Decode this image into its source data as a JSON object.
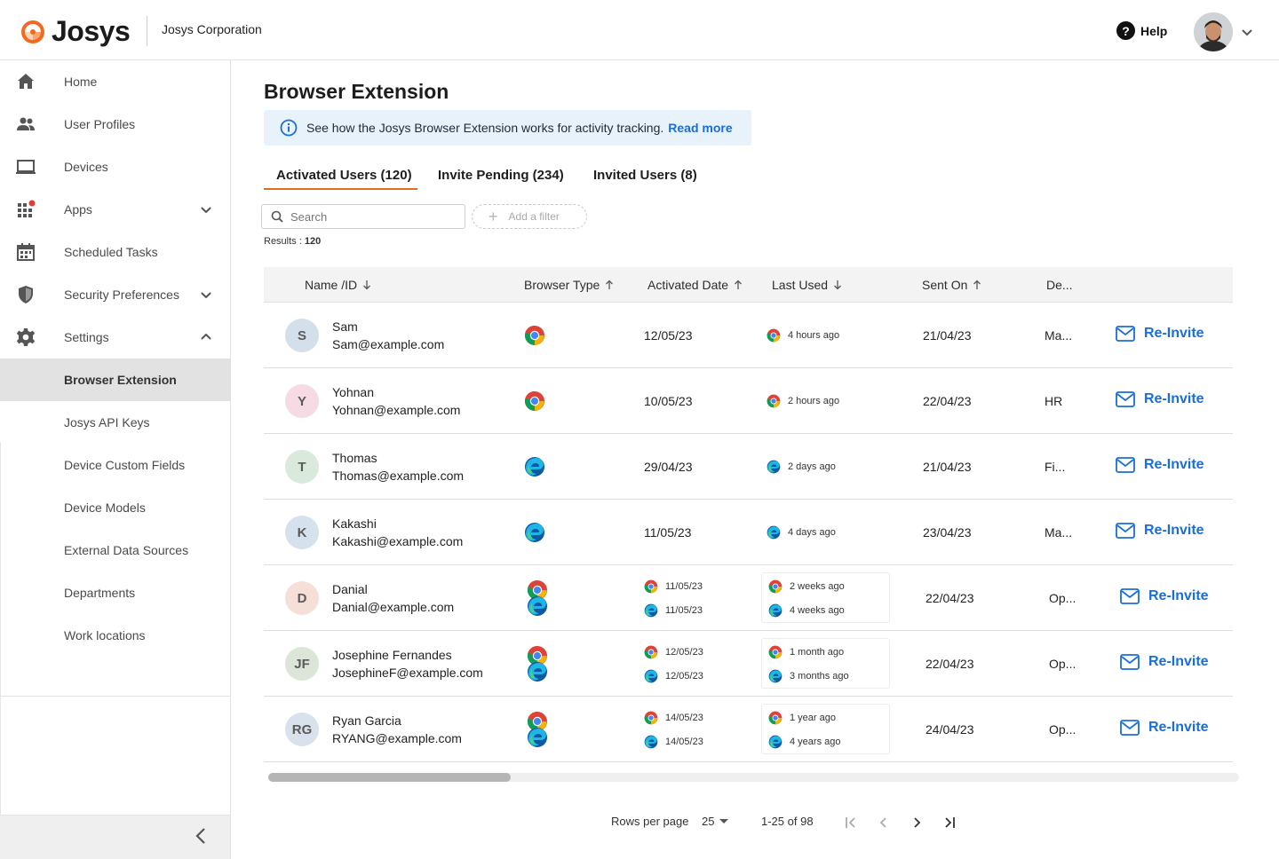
{
  "header": {
    "brand": "Josys",
    "organization": "Josys Corporation",
    "help_label": "Help"
  },
  "sidebar": {
    "items": [
      {
        "label": "Home",
        "icon": "home-icon"
      },
      {
        "label": "User Profiles",
        "icon": "users-icon"
      },
      {
        "label": "Devices",
        "icon": "laptop-icon"
      },
      {
        "label": "Apps",
        "icon": "apps-grid-icon"
      },
      {
        "label": "Scheduled Tasks",
        "icon": "calendar-icon"
      },
      {
        "label": "Security Preferences",
        "icon": "shield-icon"
      },
      {
        "label": "Settings",
        "icon": "gear-icon"
      }
    ],
    "settings_children": [
      "Browser Extension",
      "Josys API Keys",
      "Device Custom Fields",
      "Device Models",
      "External Data Sources",
      "Departments",
      "Work locations"
    ],
    "active_item": "Browser Extension"
  },
  "page": {
    "title": "Browser Extension",
    "info_text": "See how the Josys Browser Extension works for activity tracking.",
    "info_link": "Read more"
  },
  "tabs": [
    {
      "label": "Activated Users (120)",
      "active": true
    },
    {
      "label": "Invite Pending (234)",
      "active": false
    },
    {
      "label": "Invited Users (8)",
      "active": false
    }
  ],
  "search": {
    "placeholder": "Search"
  },
  "filter": {
    "label": "Add a filter"
  },
  "results": {
    "label": "Results :",
    "count": "120"
  },
  "table": {
    "columns": [
      {
        "label": "Name /ID",
        "sort": "desc"
      },
      {
        "label": "Browser Type",
        "sort": "asc"
      },
      {
        "label": "Activated Date",
        "sort": "asc"
      },
      {
        "label": "Last Used",
        "sort": "desc"
      },
      {
        "label": "Sent On",
        "sort": "asc"
      },
      {
        "label": "De...",
        "sort": ""
      }
    ],
    "action_label": "Re-Invite",
    "rows": [
      {
        "initials": "S",
        "avatar_color": "#d4dfec",
        "name": "Sam",
        "email": "Sam@example.com",
        "browsers": [
          "chrome"
        ],
        "activated": [
          "12/05/23"
        ],
        "last_used": [
          "4 hours ago"
        ],
        "sent_on": "21/04/23",
        "dept": "Ma..."
      },
      {
        "initials": "Y",
        "avatar_color": "#f7dbe4",
        "name": "Yohnan",
        "email": "Yohnan@example.com",
        "browsers": [
          "chrome"
        ],
        "activated": [
          "10/05/23"
        ],
        "last_used": [
          "2 hours ago"
        ],
        "sent_on": "22/04/23",
        "dept": "HR"
      },
      {
        "initials": "T",
        "avatar_color": "#d9e9dc",
        "name": "Thomas",
        "email": "Thomas@example.com",
        "browsers": [
          "edge"
        ],
        "activated": [
          "29/04/23"
        ],
        "last_used": [
          "2 days ago"
        ],
        "sent_on": "21/04/23",
        "dept": "Fi..."
      },
      {
        "initials": "K",
        "avatar_color": "#d6e1ee",
        "name": "Kakashi",
        "email": "Kakashi@example.com",
        "browsers": [
          "edge"
        ],
        "activated": [
          "11/05/23"
        ],
        "last_used": [
          "4 days ago"
        ],
        "sent_on": "23/04/23",
        "dept": "Ma..."
      },
      {
        "initials": "D",
        "avatar_color": "#f6dfd6",
        "name": "Danial",
        "email": "Danial@example.com",
        "browsers": [
          "chrome",
          "edge"
        ],
        "activated": [
          "11/05/23",
          "11/05/23"
        ],
        "last_used": [
          "2 weeks ago",
          "4 weeks ago"
        ],
        "sent_on": "22/04/23",
        "dept": "Op..."
      },
      {
        "initials": "JF",
        "avatar_color": "#dbe6d8",
        "name": "Josephine Fernandes",
        "email": "JosephineF@example.com",
        "browsers": [
          "chrome",
          "edge"
        ],
        "activated": [
          "12/05/23",
          "12/05/23"
        ],
        "last_used": [
          "1 month ago",
          "3 months ago"
        ],
        "sent_on": "22/04/23",
        "dept": "Op..."
      },
      {
        "initials": "RG",
        "avatar_color": "#d8e1ec",
        "name": "Ryan Garcia",
        "email": "RYANG@example.com",
        "browsers": [
          "chrome",
          "edge"
        ],
        "activated": [
          "14/05/23",
          "14/05/23"
        ],
        "last_used": [
          "1 year ago",
          "4 years ago"
        ],
        "sent_on": "24/04/23",
        "dept": "Op..."
      }
    ]
  },
  "pagination": {
    "rows_per_page_label": "Rows per page",
    "rows_per_page": "25",
    "range": "1-25 of 98"
  },
  "colors": {
    "accent": "#e36c21",
    "link": "#1a6ed8",
    "banner_bg": "#e8f2fb"
  }
}
